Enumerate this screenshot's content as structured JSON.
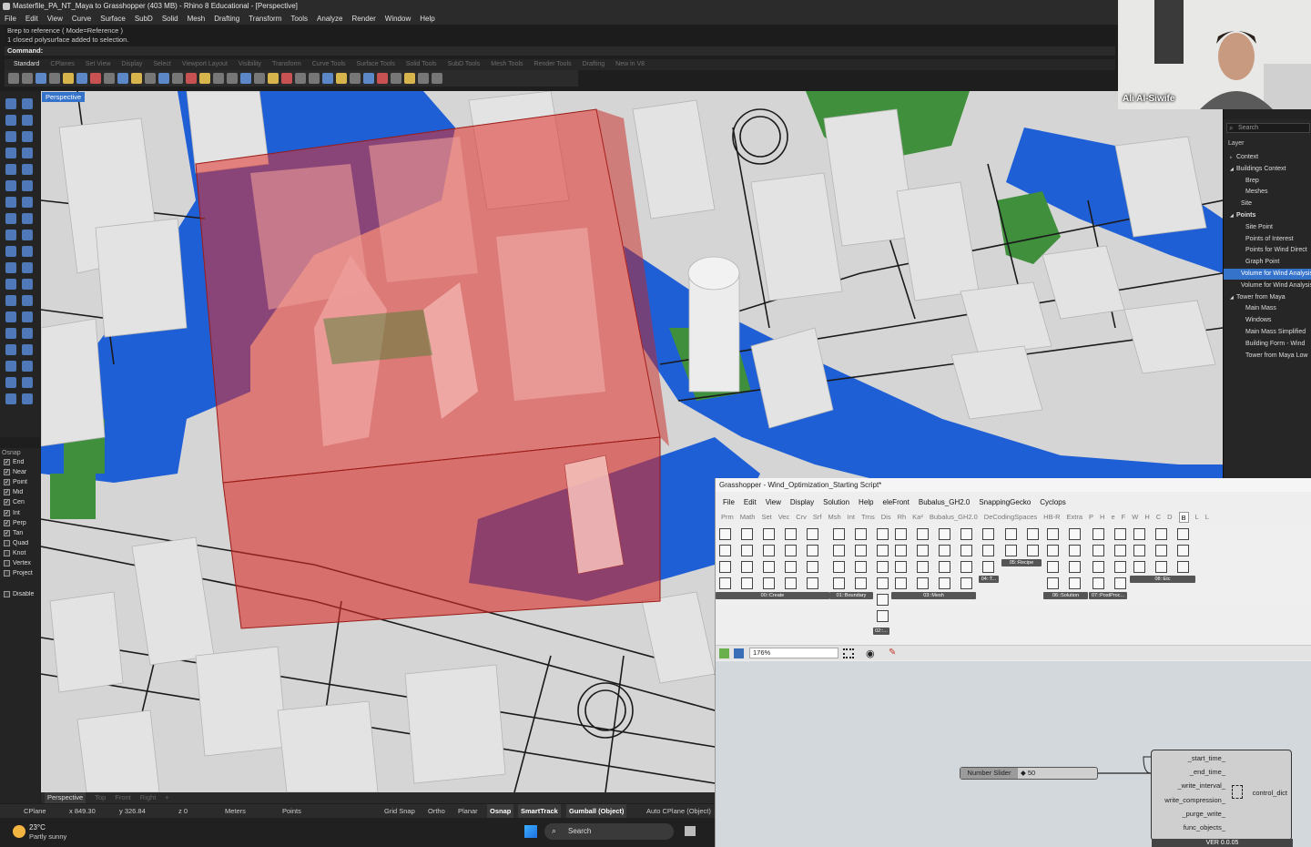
{
  "rhino": {
    "title": "Masterfile_PA_NT_Maya to Grasshopper (403 MB) - Rhino 8 Educational - [Perspective]",
    "menu": [
      "File",
      "Edit",
      "View",
      "Curve",
      "Surface",
      "SubD",
      "Solid",
      "Mesh",
      "Drafting",
      "Transform",
      "Tools",
      "Analyze",
      "Render",
      "Window",
      "Help"
    ],
    "command_history": [
      "Brep to reference ( Mode=Reference )",
      "1 closed polysurface added to selection."
    ],
    "command_prompt": "Command:",
    "toolbar_tabs": [
      "Standard",
      "CPlanes",
      "Set View",
      "Display",
      "Select",
      "Viewport Layout",
      "Visibility",
      "Transform",
      "Curve Tools",
      "Surface Tools",
      "Solid Tools",
      "SubD Tools",
      "Mesh Tools",
      "Render Tools",
      "Drafting",
      "New in V8"
    ],
    "active_tab": "Standard",
    "viewport_label": "Perspective",
    "viewport_tabs": [
      "Perspective",
      "Top",
      "Front",
      "Right",
      "+"
    ],
    "osnap": {
      "label": "Osnap",
      "items": [
        {
          "name": "End",
          "checked": true
        },
        {
          "name": "Near",
          "checked": true
        },
        {
          "name": "Point",
          "checked": true
        },
        {
          "name": "Mid",
          "checked": true
        },
        {
          "name": "Cen",
          "checked": true
        },
        {
          "name": "Int",
          "checked": true
        },
        {
          "name": "Perp",
          "checked": true
        },
        {
          "name": "Tan",
          "checked": true
        },
        {
          "name": "Quad",
          "checked": false
        },
        {
          "name": "Knot",
          "checked": false
        },
        {
          "name": "Vertex",
          "checked": false
        },
        {
          "name": "Project",
          "checked": false
        },
        {
          "name": "Disable",
          "checked": false
        }
      ]
    },
    "status": {
      "cplane": "CPlane",
      "x": "x 849.30",
      "y": "y 326.84",
      "z": "z 0",
      "units": "Meters",
      "layer": "Points",
      "grid_snap": "Grid Snap",
      "ortho": "Ortho",
      "planar": "Planar",
      "osnap": "Osnap",
      "smarttrack": "SmartTrack",
      "gumball": "Gumball (Object)",
      "auto_cplane": "Auto CPlane (Object)"
    }
  },
  "taskbar": {
    "temp": "23°C",
    "weather": "Partly sunny",
    "search": "Search"
  },
  "webcam": {
    "name": "Ali Al-Siwife"
  },
  "layers": {
    "search_placeholder": "Search",
    "title": "Layer",
    "rows": [
      {
        "label": "Context",
        "indent": 1,
        "expand": "▹",
        "selected": false,
        "bold": false
      },
      {
        "label": "Buildings Context",
        "indent": 1,
        "expand": "◢",
        "selected": false,
        "bold": false
      },
      {
        "label": "Brep",
        "indent": 3,
        "expand": "",
        "selected": false,
        "bold": false
      },
      {
        "label": "Meshes",
        "indent": 3,
        "expand": "",
        "selected": false,
        "bold": false
      },
      {
        "label": "Site",
        "indent": 2,
        "expand": "",
        "selected": false,
        "bold": false
      },
      {
        "label": "Points",
        "indent": 1,
        "expand": "◢",
        "selected": false,
        "bold": true
      },
      {
        "label": "Site Point",
        "indent": 3,
        "expand": "",
        "selected": false,
        "bold": false
      },
      {
        "label": "Points of Interest",
        "indent": 3,
        "expand": "",
        "selected": false,
        "bold": false
      },
      {
        "label": "Points for Wind Direct",
        "indent": 3,
        "expand": "",
        "selected": false,
        "bold": false
      },
      {
        "label": "Graph Point",
        "indent": 3,
        "expand": "",
        "selected": false,
        "bold": false
      },
      {
        "label": "Volume for Wind Analysis",
        "indent": 2,
        "expand": "",
        "selected": true,
        "bold": false
      },
      {
        "label": "Volume for Wind Analysis",
        "indent": 2,
        "expand": "",
        "selected": false,
        "bold": false
      },
      {
        "label": "Tower from Maya",
        "indent": 1,
        "expand": "◢",
        "selected": false,
        "bold": false
      },
      {
        "label": "Main Mass",
        "indent": 3,
        "expand": "",
        "selected": false,
        "bold": false
      },
      {
        "label": "Windows",
        "indent": 3,
        "expand": "",
        "selected": false,
        "bold": false
      },
      {
        "label": "Main Mass Simplified",
        "indent": 3,
        "expand": "",
        "selected": false,
        "bold": false
      },
      {
        "label": "Building Form - Wind",
        "indent": 3,
        "expand": "",
        "selected": false,
        "bold": false
      },
      {
        "label": "Tower from Maya Low",
        "indent": 3,
        "expand": "",
        "selected": false,
        "bold": false
      }
    ]
  },
  "grasshopper": {
    "title": "Grasshopper - Wind_Optimization_Starting Script*",
    "menu": [
      "File",
      "Edit",
      "View",
      "Display",
      "Solution",
      "Help",
      "eleFront",
      "Bubalus_GH2.0",
      "SnappingGecko",
      "Cyclops"
    ],
    "tabs": [
      "Prm",
      "Math",
      "Set",
      "Vec",
      "Crv",
      "Srf",
      "Msh",
      "Int",
      "Trns",
      "Dis",
      "Rh",
      "Ka²",
      "Bubalus_GH2.0",
      "DeCodingSpaces",
      "HB-R",
      "Extra",
      "P",
      "H",
      "e",
      "F",
      "W",
      "H",
      "C",
      "D",
      "B",
      "L",
      "L"
    ],
    "active_tab_index": 24,
    "ribbon_groups": [
      "00::Create",
      "01::Boundary",
      "02::...",
      "03::Mesh",
      "04::T...",
      "05::Recipe",
      "06::Solution",
      "07::PostProc...",
      "08::Etc"
    ],
    "zoom": "176%",
    "slider": {
      "label": "Number Slider",
      "value": "◆ 50"
    },
    "component": {
      "inputs": [
        "_start_time_",
        "_end_time_",
        "_write_interval_",
        "write_compression_",
        "_purge_write_",
        "func_objects_"
      ],
      "output": "control_dict",
      "version": "VER 0.0.05"
    }
  },
  "colors": {
    "ui_dark": "#2b2b2b",
    "selection_blue": "#3572c9",
    "water": "#1f5fd6",
    "grass": "#3f8f3c",
    "building": "#d8d8d8",
    "wind_volume": "#e0302a"
  }
}
